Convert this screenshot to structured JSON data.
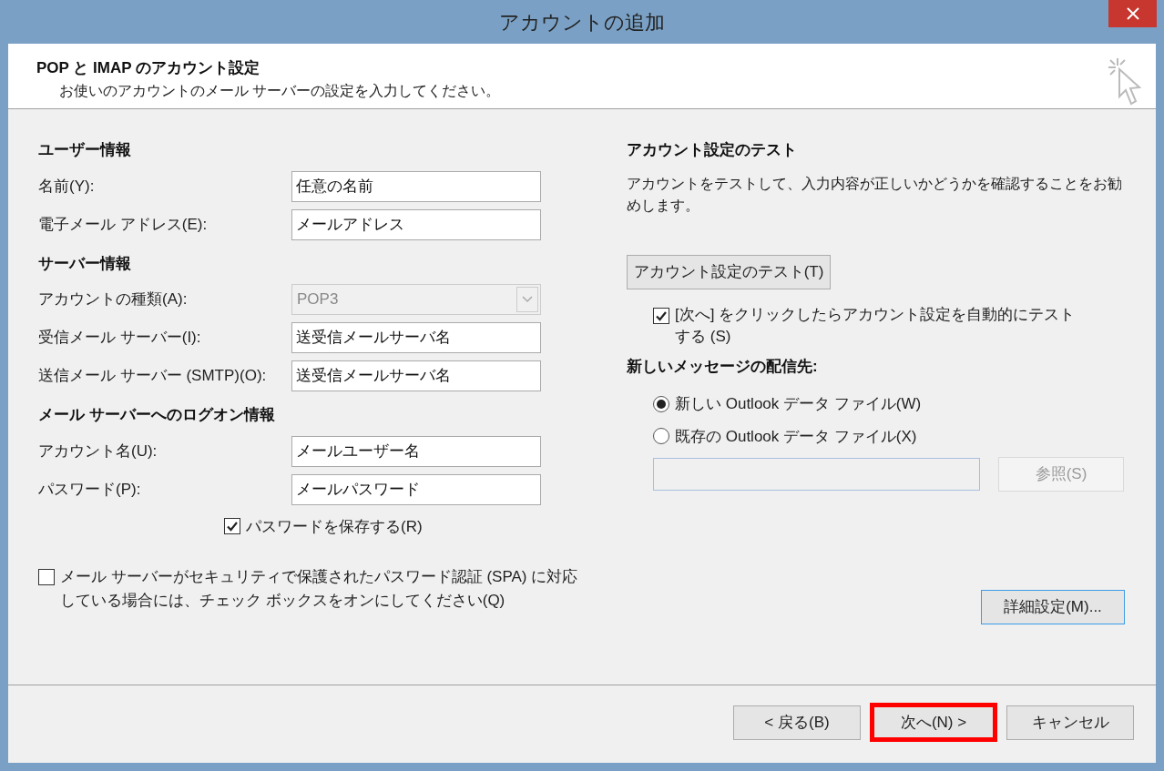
{
  "window": {
    "title": "アカウントの追加"
  },
  "header": {
    "title": "POP と IMAP のアカウント設定",
    "subtitle": "お使いのアカウントのメール サーバーの設定を入力してください。"
  },
  "left": {
    "sections": [
      {
        "heading": "ユーザー情報",
        "rows": [
          {
            "kind": "text",
            "label": "名前(Y):",
            "value": "任意の名前"
          },
          {
            "kind": "text",
            "label": "電子メール アドレス(E):",
            "value": "メールアドレス"
          }
        ]
      },
      {
        "heading": "サーバー情報",
        "rows": [
          {
            "kind": "select",
            "label": "アカウントの種類(A):",
            "value": "POP3",
            "disabled": true
          },
          {
            "kind": "text",
            "label": "受信メール サーバー(I):",
            "value": "送受信メールサーバ名"
          },
          {
            "kind": "text",
            "label": "送信メール サーバー (SMTP)(O):",
            "value": "送受信メールサーバ名"
          }
        ]
      },
      {
        "heading": "メール サーバーへのログオン情報",
        "rows": [
          {
            "kind": "text",
            "label": "アカウント名(U):",
            "value": "メールユーザー名"
          },
          {
            "kind": "text",
            "label": "パスワード(P):",
            "value": "メールパスワード"
          }
        ]
      }
    ],
    "save_password": {
      "label": "パスワードを保存する(R)",
      "checked": true
    },
    "spa": {
      "label": "メール サーバーがセキュリティで保護されたパスワード認証 (SPA) に対応している場合には、チェック ボックスをオンにしてください(Q)",
      "checked": false
    }
  },
  "right": {
    "test_heading": "アカウント設定のテスト",
    "test_description": "アカウントをテストして、入力内容が正しいかどうかを確認することをお勧めします。",
    "test_button": "アカウント設定のテスト(T)",
    "auto_test": {
      "label": "[次へ] をクリックしたらアカウント設定を自動的にテストする (S)",
      "checked": true
    },
    "delivery_heading": "新しいメッセージの配信先:",
    "delivery_options": [
      {
        "label": "新しい Outlook データ ファイル(W)",
        "selected": true
      },
      {
        "label": "既存の Outlook データ ファイル(X)",
        "selected": false
      }
    ],
    "browse_button": {
      "label": "参照(S)",
      "disabled": true
    },
    "details_button": "詳細設定(M)..."
  },
  "footer": {
    "buttons": [
      {
        "label": "< 戻る(B)",
        "highlighted": false
      },
      {
        "label": "次へ(N) >",
        "highlighted": true
      },
      {
        "label": "キャンセル",
        "highlighted": false
      }
    ]
  }
}
